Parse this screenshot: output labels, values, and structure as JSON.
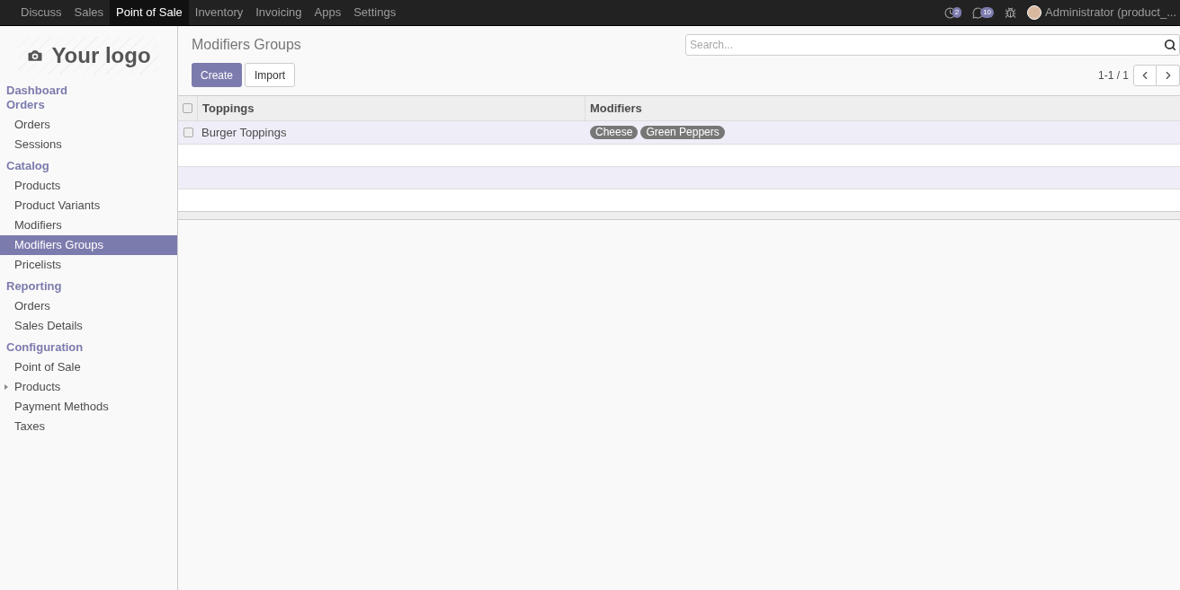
{
  "top_menu": [
    {
      "label": "Discuss",
      "selected": false
    },
    {
      "label": "Sales",
      "selected": false
    },
    {
      "label": "Point of Sale",
      "selected": true
    },
    {
      "label": "Inventory",
      "selected": false
    },
    {
      "label": "Invoicing",
      "selected": false
    },
    {
      "label": "Apps",
      "selected": false
    },
    {
      "label": "Settings",
      "selected": false
    }
  ],
  "systray": {
    "activity_count": "2",
    "message_count": "10",
    "user": "Administrator (product_..."
  },
  "logo": "Your logo",
  "sidebar": [
    {
      "title": "Dashboard"
    },
    {
      "title": "Orders",
      "items": [
        {
          "label": "Orders",
          "selected": false
        },
        {
          "label": "Sessions",
          "selected": false
        }
      ]
    },
    {
      "title": "Catalog",
      "items": [
        {
          "label": "Products",
          "selected": false
        },
        {
          "label": "Product Variants",
          "selected": false
        },
        {
          "label": "Modifiers",
          "selected": false
        },
        {
          "label": "Modifiers Groups",
          "selected": true
        },
        {
          "label": "Pricelists",
          "selected": false
        }
      ]
    },
    {
      "title": "Reporting",
      "items": [
        {
          "label": "Orders",
          "selected": false
        },
        {
          "label": "Sales Details",
          "selected": false
        }
      ]
    },
    {
      "title": "Configuration",
      "items": [
        {
          "label": "Point of Sale",
          "selected": false
        },
        {
          "label": "Products",
          "selected": false,
          "expanded": false
        },
        {
          "label": "Payment Methods",
          "selected": false
        },
        {
          "label": "Taxes",
          "selected": false
        }
      ]
    }
  ],
  "breadcrumb": "Modifiers Groups",
  "search": {
    "placeholder": "Search..."
  },
  "buttons": {
    "create": "Create",
    "import": "Import"
  },
  "pager": "1-1 / 1",
  "table": {
    "columns": [
      "Toppings",
      "Modifiers"
    ],
    "rows": [
      {
        "name": "Burger Toppings",
        "checked": false,
        "tags": [
          "Cheese",
          "Green Peppers"
        ]
      }
    ],
    "header_checked": false
  }
}
